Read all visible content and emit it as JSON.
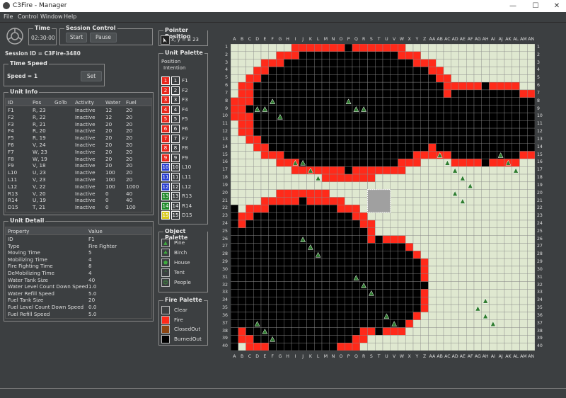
{
  "window": {
    "title": "C3Fire - Manager",
    "controls": [
      "—",
      "☐",
      "✕"
    ]
  },
  "menu": [
    "File",
    "Control",
    "Window",
    "Help"
  ],
  "time": {
    "title": "Time",
    "value": "02:30:00"
  },
  "session_control": {
    "title": "Session Control",
    "start_label": "Start",
    "pause_label": "Pause"
  },
  "session_id": "Session ID = C3Fire-3480",
  "time_speed": {
    "title": "Time Speed",
    "label": "Speed = 1",
    "set_label": "Set"
  },
  "unit_info": {
    "title": "Unit Info",
    "columns": [
      "ID",
      "Pos",
      "GoTo",
      "Activity",
      "Water",
      "Fuel"
    ],
    "rows": [
      [
        "F1",
        "R, 23",
        "",
        "Inactive",
        "12",
        "20"
      ],
      [
        "F2",
        "R, 22",
        "",
        "Inactive",
        "12",
        "20"
      ],
      [
        "F3",
        "R, 21",
        "",
        "Inactive",
        "20",
        "20"
      ],
      [
        "F4",
        "R, 20",
        "",
        "Inactive",
        "20",
        "20"
      ],
      [
        "F5",
        "R, 19",
        "",
        "Inactive",
        "20",
        "20"
      ],
      [
        "F6",
        "V, 24",
        "",
        "Inactive",
        "20",
        "20"
      ],
      [
        "F7",
        "W, 23",
        "",
        "Inactive",
        "20",
        "20"
      ],
      [
        "F8",
        "W, 19",
        "",
        "Inactive",
        "20",
        "20"
      ],
      [
        "F9",
        "V, 18",
        "",
        "Inactive",
        "20",
        "20"
      ],
      [
        "L10",
        "U, 23",
        "",
        "Inactive",
        "100",
        "20"
      ],
      [
        "L11",
        "V, 23",
        "",
        "Inactive",
        "100",
        "20"
      ],
      [
        "L12",
        "V, 22",
        "",
        "Inactive",
        "100",
        "1000"
      ],
      [
        "R13",
        "V, 20",
        "",
        "Inactive",
        "0",
        "40"
      ],
      [
        "R14",
        "U, 19",
        "",
        "Inactive",
        "0",
        "40"
      ],
      [
        "D15",
        "T, 21",
        "",
        "Inactive",
        "0",
        "100"
      ]
    ]
  },
  "unit_detail": {
    "title": "Unit Detail",
    "columns": [
      "Property",
      "Value"
    ],
    "rows": [
      [
        "ID",
        "F1"
      ],
      [
        "Type",
        "Fire Fighter"
      ],
      [
        "Moving Time",
        "5"
      ],
      [
        "Mobilizing Time",
        "4"
      ],
      [
        "Fire Fighting Time",
        "8"
      ],
      [
        "DeMobilizing Time",
        "4"
      ],
      [
        "Water Tank Size",
        "40"
      ],
      [
        "Water Level Count Down Speed",
        "1.0"
      ],
      [
        "Water Refill Speed",
        "5.0"
      ],
      [
        "Fuel Tank Size",
        "20"
      ],
      [
        "Fuel Level Count Down Speed",
        "0.0"
      ],
      [
        "Fuel Refill Speed",
        "5.0"
      ]
    ]
  },
  "pointer_position": {
    "title": "Pointer Position",
    "text": "x, y =  B 23"
  },
  "unit_palette": {
    "title": "Unit Palette",
    "header1": "Position",
    "header2": "Intention",
    "units": [
      {
        "num": "1",
        "label": "F1",
        "color": "#e8271d"
      },
      {
        "num": "2",
        "label": "F2",
        "color": "#e8271d"
      },
      {
        "num": "3",
        "label": "F3",
        "color": "#e8271d"
      },
      {
        "num": "4",
        "label": "F4",
        "color": "#e8271d"
      },
      {
        "num": "5",
        "label": "F5",
        "color": "#e8271d"
      },
      {
        "num": "6",
        "label": "F6",
        "color": "#e8271d"
      },
      {
        "num": "7",
        "label": "F7",
        "color": "#e8271d"
      },
      {
        "num": "8",
        "label": "F8",
        "color": "#e8271d"
      },
      {
        "num": "9",
        "label": "F9",
        "color": "#e8271d"
      },
      {
        "num": "10",
        "label": "L10",
        "color": "#2a40d0"
      },
      {
        "num": "11",
        "label": "L11",
        "color": "#2a40d0"
      },
      {
        "num": "12",
        "label": "L12",
        "color": "#2a40d0"
      },
      {
        "num": "13",
        "label": "R13",
        "color": "#1f8a2a"
      },
      {
        "num": "14",
        "label": "R14",
        "color": "#1f8a2a"
      },
      {
        "num": "15",
        "label": "D15",
        "color": "#d7c91e"
      }
    ]
  },
  "object_palette": {
    "title": "Object Palette",
    "items": [
      {
        "label": "Pine",
        "icon": "pine-icon",
        "glyph": "▲"
      },
      {
        "label": "Birch",
        "icon": "birch-icon",
        "glyph": "♣"
      },
      {
        "label": "House",
        "icon": "house-icon",
        "glyph": "⬟"
      },
      {
        "label": "Tent",
        "icon": "tent-icon",
        "glyph": "⌃"
      },
      {
        "label": "People",
        "icon": "people-icon",
        "glyph": "☺"
      }
    ]
  },
  "fire_palette": {
    "title": "Fire Palette",
    "items": [
      {
        "label": "Clear",
        "color": "#3c3f41"
      },
      {
        "label": "Fire",
        "color": "#ff2a1a"
      },
      {
        "label": "ClosedOut",
        "color": "#8b4513"
      },
      {
        "label": "BurnedOut",
        "color": "#000000"
      }
    ]
  },
  "map": {
    "columns": [
      "A",
      "B",
      "C",
      "D",
      "E",
      "F",
      "G",
      "H",
      "I",
      "J",
      "K",
      "L",
      "M",
      "N",
      "O",
      "P",
      "Q",
      "R",
      "S",
      "T",
      "U",
      "V",
      "W",
      "X",
      "Y",
      "Z",
      "AA",
      "AB",
      "AC",
      "AD",
      "AE",
      "AF",
      "AG",
      "AH",
      "AI",
      "AJ",
      "AK",
      "AL",
      "AM",
      "AN"
    ],
    "rows": 40,
    "colors": {
      "clear": "#dfe8d0",
      "fire": "#ff2a1a",
      "burned": "#000000",
      "grid": "#8a8a8a",
      "pine": "#2f7d2f"
    }
  }
}
